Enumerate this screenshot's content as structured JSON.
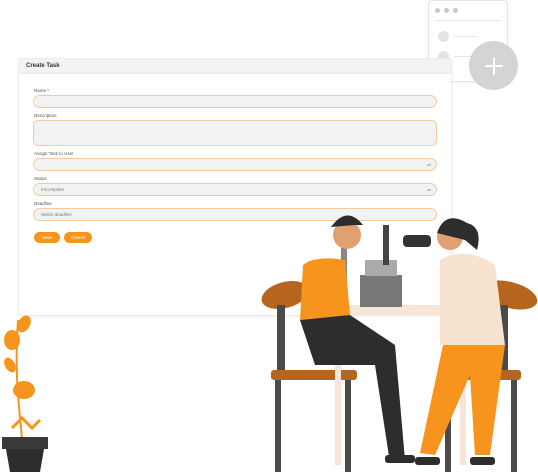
{
  "form": {
    "title": "Create Task",
    "name_label": "Name *",
    "description_label": "Description",
    "assign_label": "Assign Task to User",
    "status_label": "Status",
    "status_value": "InComplete",
    "deadline_label": "Deadline",
    "deadline_placeholder": "Select deadline",
    "save_label": "Save",
    "cancel_label": "Cancel"
  },
  "colors": {
    "accent": "#f7941d",
    "field_border": "#f2c9a0",
    "plus_button": "#d4d4d4"
  },
  "icons": {
    "add": "plus-icon",
    "select": "chevron-icon"
  }
}
